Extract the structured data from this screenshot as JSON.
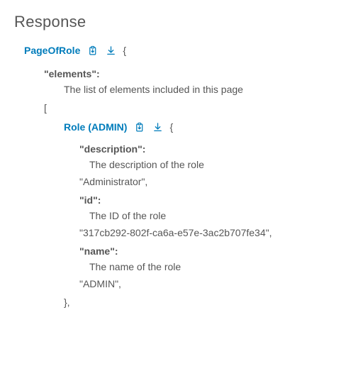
{
  "section_title": "Response",
  "schema": {
    "name": "PageOfRole",
    "open": "{",
    "fields": {
      "elements": {
        "key": "\"elements\":",
        "desc": "The list of elements included in this page",
        "open_array": "[",
        "item": {
          "type_label": "Role (ADMIN)",
          "open": "{",
          "fields": {
            "description": {
              "key": "\"description\":",
              "desc": "The description of the role",
              "value": "\"Administrator\","
            },
            "id": {
              "key": "\"id\":",
              "desc": "The ID of the role",
              "value": "\"317cb292-802f-ca6a-e57e-3ac2b707fe34\","
            },
            "name": {
              "key": "\"name\":",
              "desc": "The name of the role",
              "value": "\"ADMIN\","
            }
          },
          "close": "},"
        }
      }
    }
  }
}
